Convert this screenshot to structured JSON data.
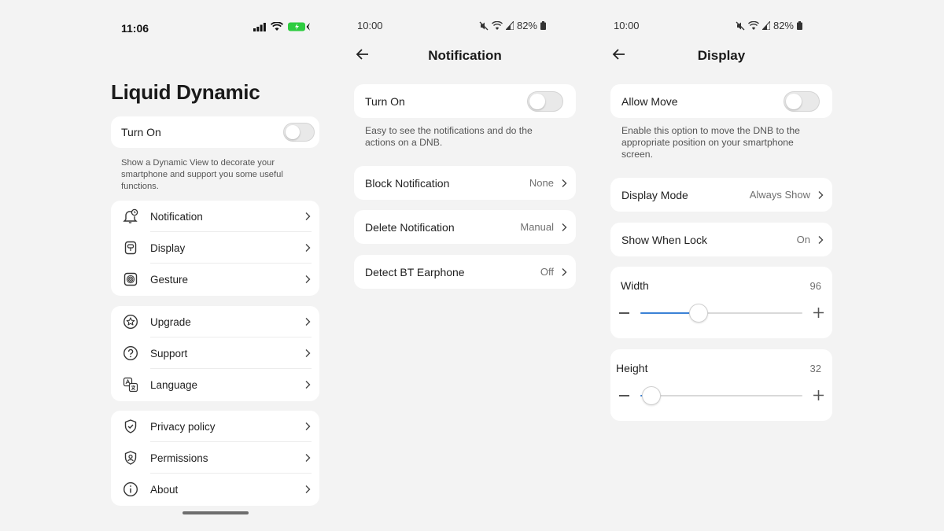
{
  "screens": {
    "main": {
      "status": {
        "time": "11:06"
      },
      "title": "Liquid Dynamic",
      "turn_on": {
        "label": "Turn On",
        "enabled": false
      },
      "description": "Show a Dynamic View to decorate your smartphone and support you some useful functions.",
      "group1": [
        {
          "label": "Notification",
          "icon": "bell-clock-icon"
        },
        {
          "label": "Display",
          "icon": "display-icon"
        },
        {
          "label": "Gesture",
          "icon": "fingerprint-icon"
        }
      ],
      "group2": [
        {
          "label": "Upgrade",
          "icon": "star-icon"
        },
        {
          "label": "Support",
          "icon": "question-icon"
        },
        {
          "label": "Language",
          "icon": "translate-icon"
        }
      ],
      "group3": [
        {
          "label": "Privacy policy",
          "icon": "shield-check-icon"
        },
        {
          "label": "Permissions",
          "icon": "shield-user-icon"
        },
        {
          "label": "About",
          "icon": "info-icon"
        }
      ]
    },
    "notification": {
      "status": {
        "time": "10:00",
        "battery": "82%"
      },
      "title": "Notification",
      "turn_on": {
        "label": "Turn On",
        "enabled": false
      },
      "description": "Easy to see the notifications and do the actions on a DNB.",
      "rows": [
        {
          "label": "Block Notification",
          "value": "None"
        },
        {
          "label": "Delete Notification",
          "value": "Manual"
        },
        {
          "label": "Detect BT Earphone",
          "value": "Off"
        }
      ]
    },
    "display": {
      "status": {
        "time": "10:00",
        "battery": "82%"
      },
      "title": "Display",
      "allow_move": {
        "label": "Allow Move",
        "enabled": false
      },
      "description": "Enable this option to move the DNB to the appropriate position on your smartphone screen.",
      "rows": [
        {
          "label": "Display Mode",
          "value": "Always Show"
        },
        {
          "label": "Show When Lock",
          "value": "On"
        }
      ],
      "width": {
        "label": "Width",
        "value": "96",
        "fraction": 0.36
      },
      "height": {
        "label": "Height",
        "value": "32",
        "fraction": 0.07
      }
    }
  },
  "colors": {
    "accent": "#3b82d6",
    "background": "#f3f3f3",
    "card": "#ffffff",
    "battery_green": "#2ecc40"
  }
}
